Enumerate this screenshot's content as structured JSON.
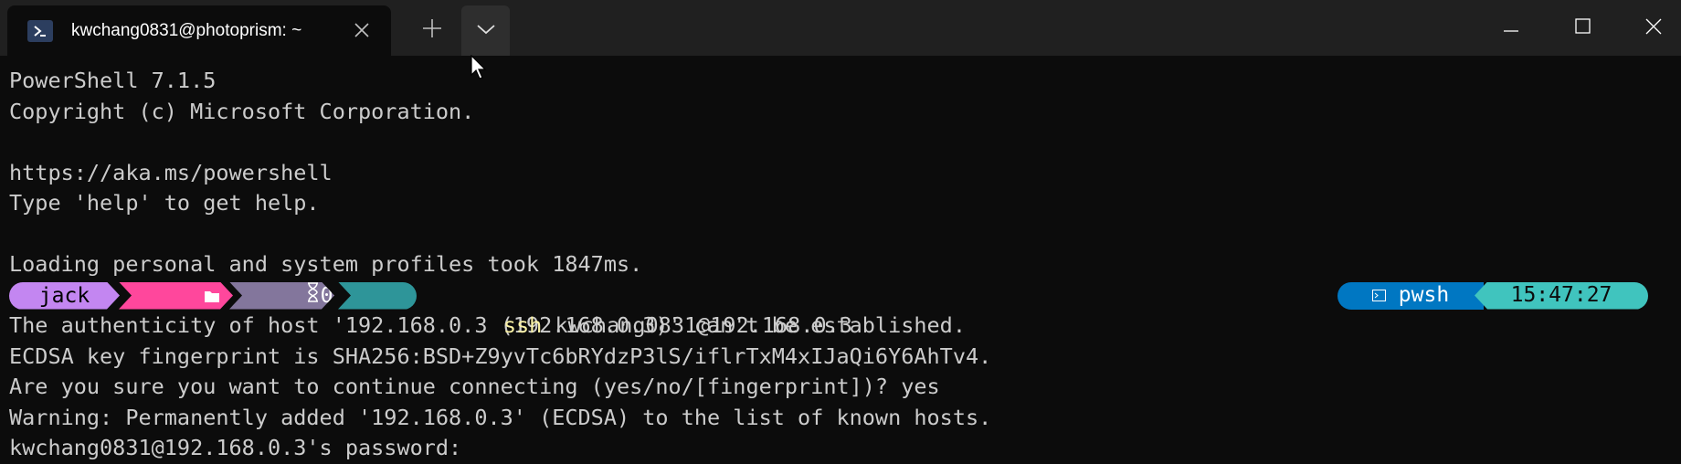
{
  "tab": {
    "title": "kwchang0831@photoprism: ~"
  },
  "terminal": {
    "lines_before": [
      "PowerShell 7.1.5",
      "Copyright (c) Microsoft Corporation.",
      "",
      "https://aka.ms/powershell",
      "Type 'help' to get help.",
      "",
      "Loading personal and system profiles took 1847ms."
    ],
    "prompt": {
      "user": "jack",
      "path": "~",
      "exec_time": "0ms",
      "command": "ssh",
      "command_args": " kwchang0831@192.168.0.3",
      "shell": "pwsh",
      "time": "15:47:27"
    },
    "lines_after": [
      "The authenticity of host '192.168.0.3 (192.168.0.3)' can't be established.",
      "ECDSA key fingerprint is SHA256:BSD+Z9yvTc6bRYdzP3lS/iflrTxM4xIJaQi6Y6AhTv4.",
      "Are you sure you want to continue connecting (yes/no/[fingerprint])? yes",
      "Warning: Permanently added '192.168.0.3' (ECDSA) to the list of known hosts.",
      "kwchang0831@192.168.0.3's password:"
    ]
  },
  "icons": {
    "tab": "powershell-icon",
    "close": "close-icon",
    "new_tab": "plus-icon",
    "dropdown": "chevron-down-icon",
    "minimize": "minimize-icon",
    "maximize": "maximize-icon",
    "window_close": "window-close-icon",
    "folder": "folder-icon",
    "hourglass": "hourglass-icon",
    "status": "hand-icon"
  },
  "colors": {
    "background": "#0c0c0c",
    "titlebar": "#202020",
    "user_segment": "#c386f1",
    "path_segment": "#ff479c",
    "exec_segment": "#83769c",
    "status_segment": "#2e9599",
    "shell_segment": "#0077c2",
    "time_segment": "#40c4be",
    "command": "#f9f1a5"
  }
}
